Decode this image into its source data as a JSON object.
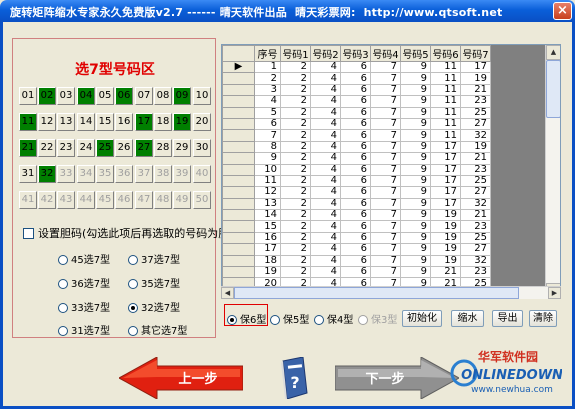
{
  "window": {
    "title": "旋转矩阵缩水专家永久免费版v2.7 ------ 晴天软件出品  晴天彩票网:  http://www.qtsoft.net",
    "close_glyph": "×"
  },
  "left_panel": {
    "title": "选7型号码区",
    "numbers": [
      {
        "label": "01",
        "state": "normal"
      },
      {
        "label": "02",
        "state": "selected"
      },
      {
        "label": "03",
        "state": "normal"
      },
      {
        "label": "04",
        "state": "selected"
      },
      {
        "label": "05",
        "state": "normal"
      },
      {
        "label": "06",
        "state": "selected"
      },
      {
        "label": "07",
        "state": "normal"
      },
      {
        "label": "08",
        "state": "normal"
      },
      {
        "label": "09",
        "state": "selected"
      },
      {
        "label": "10",
        "state": "normal"
      },
      {
        "label": "11",
        "state": "selected"
      },
      {
        "label": "12",
        "state": "normal"
      },
      {
        "label": "13",
        "state": "normal"
      },
      {
        "label": "14",
        "state": "normal"
      },
      {
        "label": "15",
        "state": "normal"
      },
      {
        "label": "16",
        "state": "normal"
      },
      {
        "label": "17",
        "state": "selected"
      },
      {
        "label": "18",
        "state": "normal"
      },
      {
        "label": "19",
        "state": "selected"
      },
      {
        "label": "20",
        "state": "normal"
      },
      {
        "label": "21",
        "state": "selected"
      },
      {
        "label": "22",
        "state": "normal"
      },
      {
        "label": "23",
        "state": "normal"
      },
      {
        "label": "24",
        "state": "normal"
      },
      {
        "label": "25",
        "state": "selected"
      },
      {
        "label": "26",
        "state": "normal"
      },
      {
        "label": "27",
        "state": "selected"
      },
      {
        "label": "28",
        "state": "normal"
      },
      {
        "label": "29",
        "state": "normal"
      },
      {
        "label": "30",
        "state": "normal"
      },
      {
        "label": "31",
        "state": "normal"
      },
      {
        "label": "32",
        "state": "selected"
      },
      {
        "label": "33",
        "state": "disabled"
      },
      {
        "label": "34",
        "state": "disabled"
      },
      {
        "label": "35",
        "state": "disabled"
      },
      {
        "label": "36",
        "state": "disabled"
      },
      {
        "label": "37",
        "state": "disabled"
      },
      {
        "label": "38",
        "state": "disabled"
      },
      {
        "label": "39",
        "state": "disabled"
      },
      {
        "label": "40",
        "state": "disabled"
      },
      {
        "label": "41",
        "state": "disabled"
      },
      {
        "label": "42",
        "state": "disabled"
      },
      {
        "label": "43",
        "state": "disabled"
      },
      {
        "label": "44",
        "state": "disabled"
      },
      {
        "label": "45",
        "state": "disabled"
      },
      {
        "label": "46",
        "state": "disabled"
      },
      {
        "label": "47",
        "state": "disabled"
      },
      {
        "label": "48",
        "state": "disabled"
      },
      {
        "label": "49",
        "state": "disabled"
      },
      {
        "label": "50",
        "state": "disabled"
      }
    ],
    "group_checkbox_label": "设置胆码(勾选此项后再选取的号码为胆码)",
    "group_checkbox_checked": false,
    "type_options": [
      {
        "label": "45选7型",
        "checked": false
      },
      {
        "label": "37选7型",
        "checked": false
      },
      {
        "label": "36选7型",
        "checked": false
      },
      {
        "label": "35选7型",
        "checked": false
      },
      {
        "label": "33选7型",
        "checked": false
      },
      {
        "label": "32选7型",
        "checked": true
      },
      {
        "label": "31选7型",
        "checked": false
      },
      {
        "label": "其它选7型",
        "checked": false
      }
    ]
  },
  "table": {
    "headers": [
      "序号",
      "号码1",
      "号码2",
      "号码3",
      "号码4",
      "号码5",
      "号码6",
      "号码7"
    ],
    "current_row_indicator": "▶",
    "rows": [
      [
        "1",
        "2",
        "4",
        "6",
        "7",
        "9",
        "11",
        "17"
      ],
      [
        "2",
        "2",
        "4",
        "6",
        "7",
        "9",
        "11",
        "19"
      ],
      [
        "3",
        "2",
        "4",
        "6",
        "7",
        "9",
        "11",
        "21"
      ],
      [
        "4",
        "2",
        "4",
        "6",
        "7",
        "9",
        "11",
        "23"
      ],
      [
        "5",
        "2",
        "4",
        "6",
        "7",
        "9",
        "11",
        "25"
      ],
      [
        "6",
        "2",
        "4",
        "6",
        "7",
        "9",
        "11",
        "27"
      ],
      [
        "7",
        "2",
        "4",
        "6",
        "7",
        "9",
        "11",
        "32"
      ],
      [
        "8",
        "2",
        "4",
        "6",
        "7",
        "9",
        "17",
        "19"
      ],
      [
        "9",
        "2",
        "4",
        "6",
        "7",
        "9",
        "17",
        "21"
      ],
      [
        "10",
        "2",
        "4",
        "6",
        "7",
        "9",
        "17",
        "23"
      ],
      [
        "11",
        "2",
        "4",
        "6",
        "7",
        "9",
        "17",
        "25"
      ],
      [
        "12",
        "2",
        "4",
        "6",
        "7",
        "9",
        "17",
        "27"
      ],
      [
        "13",
        "2",
        "4",
        "6",
        "7",
        "9",
        "17",
        "32"
      ],
      [
        "14",
        "2",
        "4",
        "6",
        "7",
        "9",
        "19",
        "21"
      ],
      [
        "15",
        "2",
        "4",
        "6",
        "7",
        "9",
        "19",
        "23"
      ],
      [
        "16",
        "2",
        "4",
        "6",
        "7",
        "9",
        "19",
        "25"
      ],
      [
        "17",
        "2",
        "4",
        "6",
        "7",
        "9",
        "19",
        "27"
      ],
      [
        "18",
        "2",
        "4",
        "6",
        "7",
        "9",
        "19",
        "32"
      ],
      [
        "19",
        "2",
        "4",
        "6",
        "7",
        "9",
        "21",
        "23"
      ],
      [
        "20",
        "2",
        "4",
        "6",
        "7",
        "9",
        "21",
        "25"
      ]
    ]
  },
  "guarantee_options": [
    {
      "label": "保6型",
      "checked": true,
      "enabled": true
    },
    {
      "label": "保5型",
      "checked": false,
      "enabled": true
    },
    {
      "label": "保4型",
      "checked": false,
      "enabled": true
    },
    {
      "label": "保3型",
      "checked": false,
      "enabled": false
    }
  ],
  "actions": {
    "init": "初始化",
    "shrink": "缩水",
    "export": "导出",
    "clear": "清除"
  },
  "nav": {
    "prev": "上一步",
    "next": "下一步",
    "help_glyph": "?"
  },
  "watermark": {
    "cn": "华军软件园",
    "en": "ONLINEDOWN",
    "url": "www.newhua.com"
  },
  "colors": {
    "selected_number": "#007f00",
    "panel_title": "#e00000",
    "titlebar": "#0a5fd9",
    "prev_arrow": "#e02010",
    "next_arrow": "#909090"
  }
}
